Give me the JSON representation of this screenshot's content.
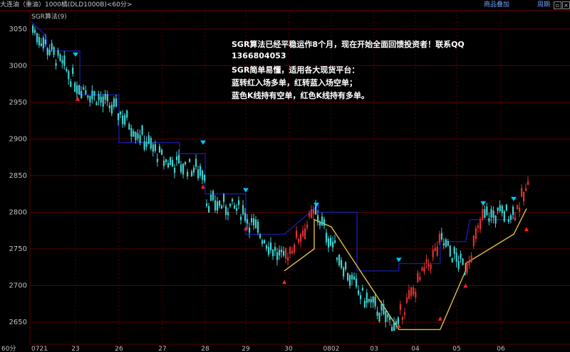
{
  "header": {
    "instrument": "大连油（重油）1000橘(DLD1000B)<60分>",
    "add_label": "商品叠加",
    "period_label": "周期"
  },
  "indicator_label": "SGR算法(9)",
  "annotation": [
    "SGR算法已经平稳运作8个月，现在开始全面回馈投资者！联系QQ",
    "1366804053",
    "SGR简单易懂，适用各大现货平台：",
    "蓝转红入场多单，红转蓝入场空单；",
    "蓝色K线持有空单，红色K线持有多单。"
  ],
  "colors": {
    "up_candle": "#e03030",
    "down_candle": "#40d0d0",
    "blue_line": "#1a1aa0",
    "yellow_line": "#e0c040",
    "grid": "#5a0000",
    "axis_text": "#c0c0c0"
  },
  "chart_data": {
    "type": "candlestick",
    "interval_label": "60分",
    "ylim": [
      2620,
      3075
    ],
    "y_ticks": [
      2650,
      2700,
      2750,
      2800,
      2850,
      2900,
      2950,
      3000,
      3050
    ],
    "x_ticks": [
      "0721",
      "23",
      "26",
      "27",
      "28",
      "29",
      "30",
      "0802",
      "03",
      "04",
      "05",
      "06"
    ],
    "segments": [
      {
        "start_tick": 0,
        "end_tick": 1.0,
        "from": 3050,
        "to": 2975,
        "trend": "down"
      },
      {
        "start_tick": 1.0,
        "end_tick": 2.0,
        "from": 2975,
        "to": 2935,
        "trend": "down"
      },
      {
        "start_tick": 2.0,
        "end_tick": 3.0,
        "from": 2935,
        "to": 2870,
        "trend": "down"
      },
      {
        "start_tick": 3.0,
        "end_tick": 4.0,
        "from": 2870,
        "to": 2855,
        "trend": "down"
      },
      {
        "start_tick": 4.0,
        "end_tick": 5.0,
        "from": 2815,
        "to": 2800,
        "trend": "down"
      },
      {
        "start_tick": 5.0,
        "end_tick": 5.9,
        "from": 2790,
        "to": 2730,
        "trend": "down"
      },
      {
        "start_tick": 5.9,
        "end_tick": 6.6,
        "from": 2740,
        "to": 2800,
        "trend": "up"
      },
      {
        "start_tick": 6.6,
        "end_tick": 7.6,
        "from": 2800,
        "to": 2690,
        "trend": "down"
      },
      {
        "start_tick": 7.6,
        "end_tick": 8.6,
        "from": 2690,
        "to": 2640,
        "trend": "down"
      },
      {
        "start_tick": 8.6,
        "end_tick": 9.6,
        "from": 2660,
        "to": 2760,
        "trend": "up"
      },
      {
        "start_tick": 9.6,
        "end_tick": 10.2,
        "from": 2760,
        "to": 2720,
        "trend": "down"
      },
      {
        "start_tick": 10.2,
        "end_tick": 10.6,
        "from": 2730,
        "to": 2800,
        "trend": "up"
      },
      {
        "start_tick": 10.6,
        "end_tick": 11.3,
        "from": 2795,
        "to": 2800,
        "trend": "down"
      },
      {
        "start_tick": 11.3,
        "end_tick": 11.65,
        "from": 2800,
        "to": 2838,
        "trend": "up"
      }
    ],
    "blue_stop": [
      [
        0,
        3060
      ],
      [
        0.35,
        3040
      ],
      [
        0.35,
        3020
      ],
      [
        1.1,
        3020
      ],
      [
        1.1,
        2960
      ],
      [
        2.0,
        2960
      ],
      [
        2.0,
        2895
      ],
      [
        3.4,
        2895
      ],
      [
        3.4,
        2880
      ],
      [
        4.0,
        2880
      ],
      [
        4.0,
        2825
      ],
      [
        5.0,
        2825
      ],
      [
        5.0,
        2770
      ],
      [
        5.9,
        2770
      ],
      [
        6.7,
        2810
      ],
      [
        6.7,
        2800
      ],
      [
        7.6,
        2800
      ],
      [
        7.6,
        2720
      ],
      [
        8.6,
        2720
      ],
      [
        8.6,
        2730
      ],
      [
        9.6,
        2730
      ],
      [
        9.6,
        2760
      ],
      [
        10.2,
        2760
      ],
      [
        10.3,
        2790
      ],
      [
        11.3,
        2790
      ],
      [
        11.3,
        2800
      ]
    ],
    "yellow_stop": [
      [
        5.9,
        2720
      ],
      [
        6.6,
        2750
      ],
      [
        6.6,
        2790
      ],
      [
        7.0,
        2780
      ],
      [
        8.6,
        2640
      ],
      [
        9.6,
        2640
      ],
      [
        10.2,
        2720
      ],
      [
        10.2,
        2730
      ],
      [
        11.3,
        2770
      ],
      [
        11.6,
        2805
      ]
    ],
    "sell_signals": [
      [
        1.0,
        3015
      ],
      [
        3.95,
        2895
      ],
      [
        5.0,
        2830
      ],
      [
        6.65,
        2810
      ],
      [
        8.6,
        2735
      ],
      [
        10.6,
        2812
      ],
      [
        11.3,
        2818
      ]
    ],
    "buy_signals": [
      [
        1.05,
        2955
      ],
      [
        3.95,
        2835
      ],
      [
        5.0,
        2778
      ],
      [
        5.9,
        2705
      ],
      [
        8.6,
        2645
      ],
      [
        9.6,
        2655
      ],
      [
        10.2,
        2700
      ],
      [
        11.6,
        2777
      ]
    ]
  }
}
